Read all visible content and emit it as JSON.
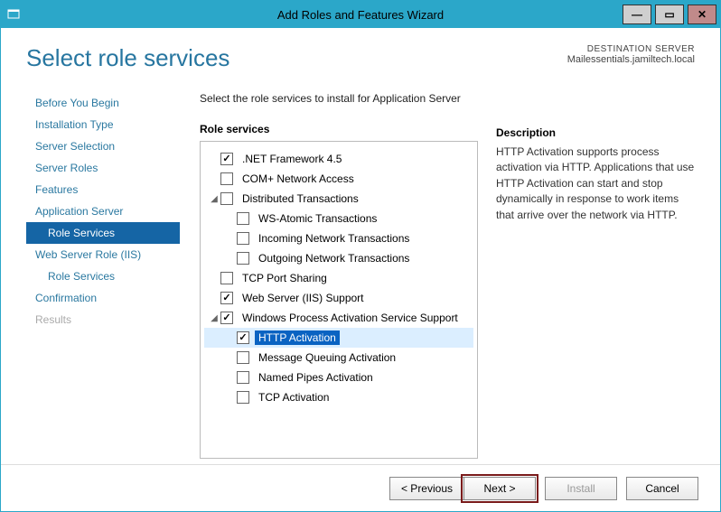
{
  "titlebar": {
    "title": "Add Roles and Features Wizard"
  },
  "header": {
    "title": "Select role services",
    "destination_label": "DESTINATION SERVER",
    "destination_value": "Mailessentials.jamiltech.local"
  },
  "nav": {
    "items": [
      {
        "label": "Before You Begin",
        "level": 0
      },
      {
        "label": "Installation Type",
        "level": 0
      },
      {
        "label": "Server Selection",
        "level": 0
      },
      {
        "label": "Server Roles",
        "level": 0
      },
      {
        "label": "Features",
        "level": 0
      },
      {
        "label": "Application Server",
        "level": 0
      },
      {
        "label": "Role Services",
        "level": 1,
        "selected": true
      },
      {
        "label": "Web Server Role (IIS)",
        "level": 0
      },
      {
        "label": "Role Services",
        "level": 1
      },
      {
        "label": "Confirmation",
        "level": 0
      },
      {
        "label": "Results",
        "level": 0,
        "disabled": true
      }
    ]
  },
  "main": {
    "instruction": "Select the role services to install for Application Server",
    "tree_label": "Role services",
    "desc_label": "Description",
    "desc_text": "HTTP Activation supports process activation via HTTP. Applications that use HTTP Activation can start and stop dynamically in response to work items that arrive over the network via HTTP.",
    "tree": [
      {
        "label": ".NET Framework 4.5",
        "indent": 0,
        "checked": true,
        "expander": ""
      },
      {
        "label": "COM+ Network Access",
        "indent": 0,
        "checked": false,
        "expander": ""
      },
      {
        "label": "Distributed Transactions",
        "indent": 0,
        "checked": false,
        "expander": "◢"
      },
      {
        "label": "WS-Atomic Transactions",
        "indent": 1,
        "checked": false,
        "expander": ""
      },
      {
        "label": "Incoming Network Transactions",
        "indent": 1,
        "checked": false,
        "expander": ""
      },
      {
        "label": "Outgoing Network Transactions",
        "indent": 1,
        "checked": false,
        "expander": ""
      },
      {
        "label": "TCP Port Sharing",
        "indent": 0,
        "checked": false,
        "expander": ""
      },
      {
        "label": "Web Server (IIS) Support",
        "indent": 0,
        "checked": true,
        "expander": ""
      },
      {
        "label": "Windows Process Activation Service Support",
        "indent": 0,
        "checked": true,
        "expander": "◢"
      },
      {
        "label": "HTTP Activation",
        "indent": 1,
        "checked": true,
        "expander": "",
        "selected": true,
        "highlight": true
      },
      {
        "label": "Message Queuing Activation",
        "indent": 1,
        "checked": false,
        "expander": ""
      },
      {
        "label": "Named Pipes Activation",
        "indent": 1,
        "checked": false,
        "expander": ""
      },
      {
        "label": "TCP Activation",
        "indent": 1,
        "checked": false,
        "expander": ""
      }
    ]
  },
  "footer": {
    "previous": "< Previous",
    "next": "Next >",
    "install": "Install",
    "cancel": "Cancel"
  }
}
